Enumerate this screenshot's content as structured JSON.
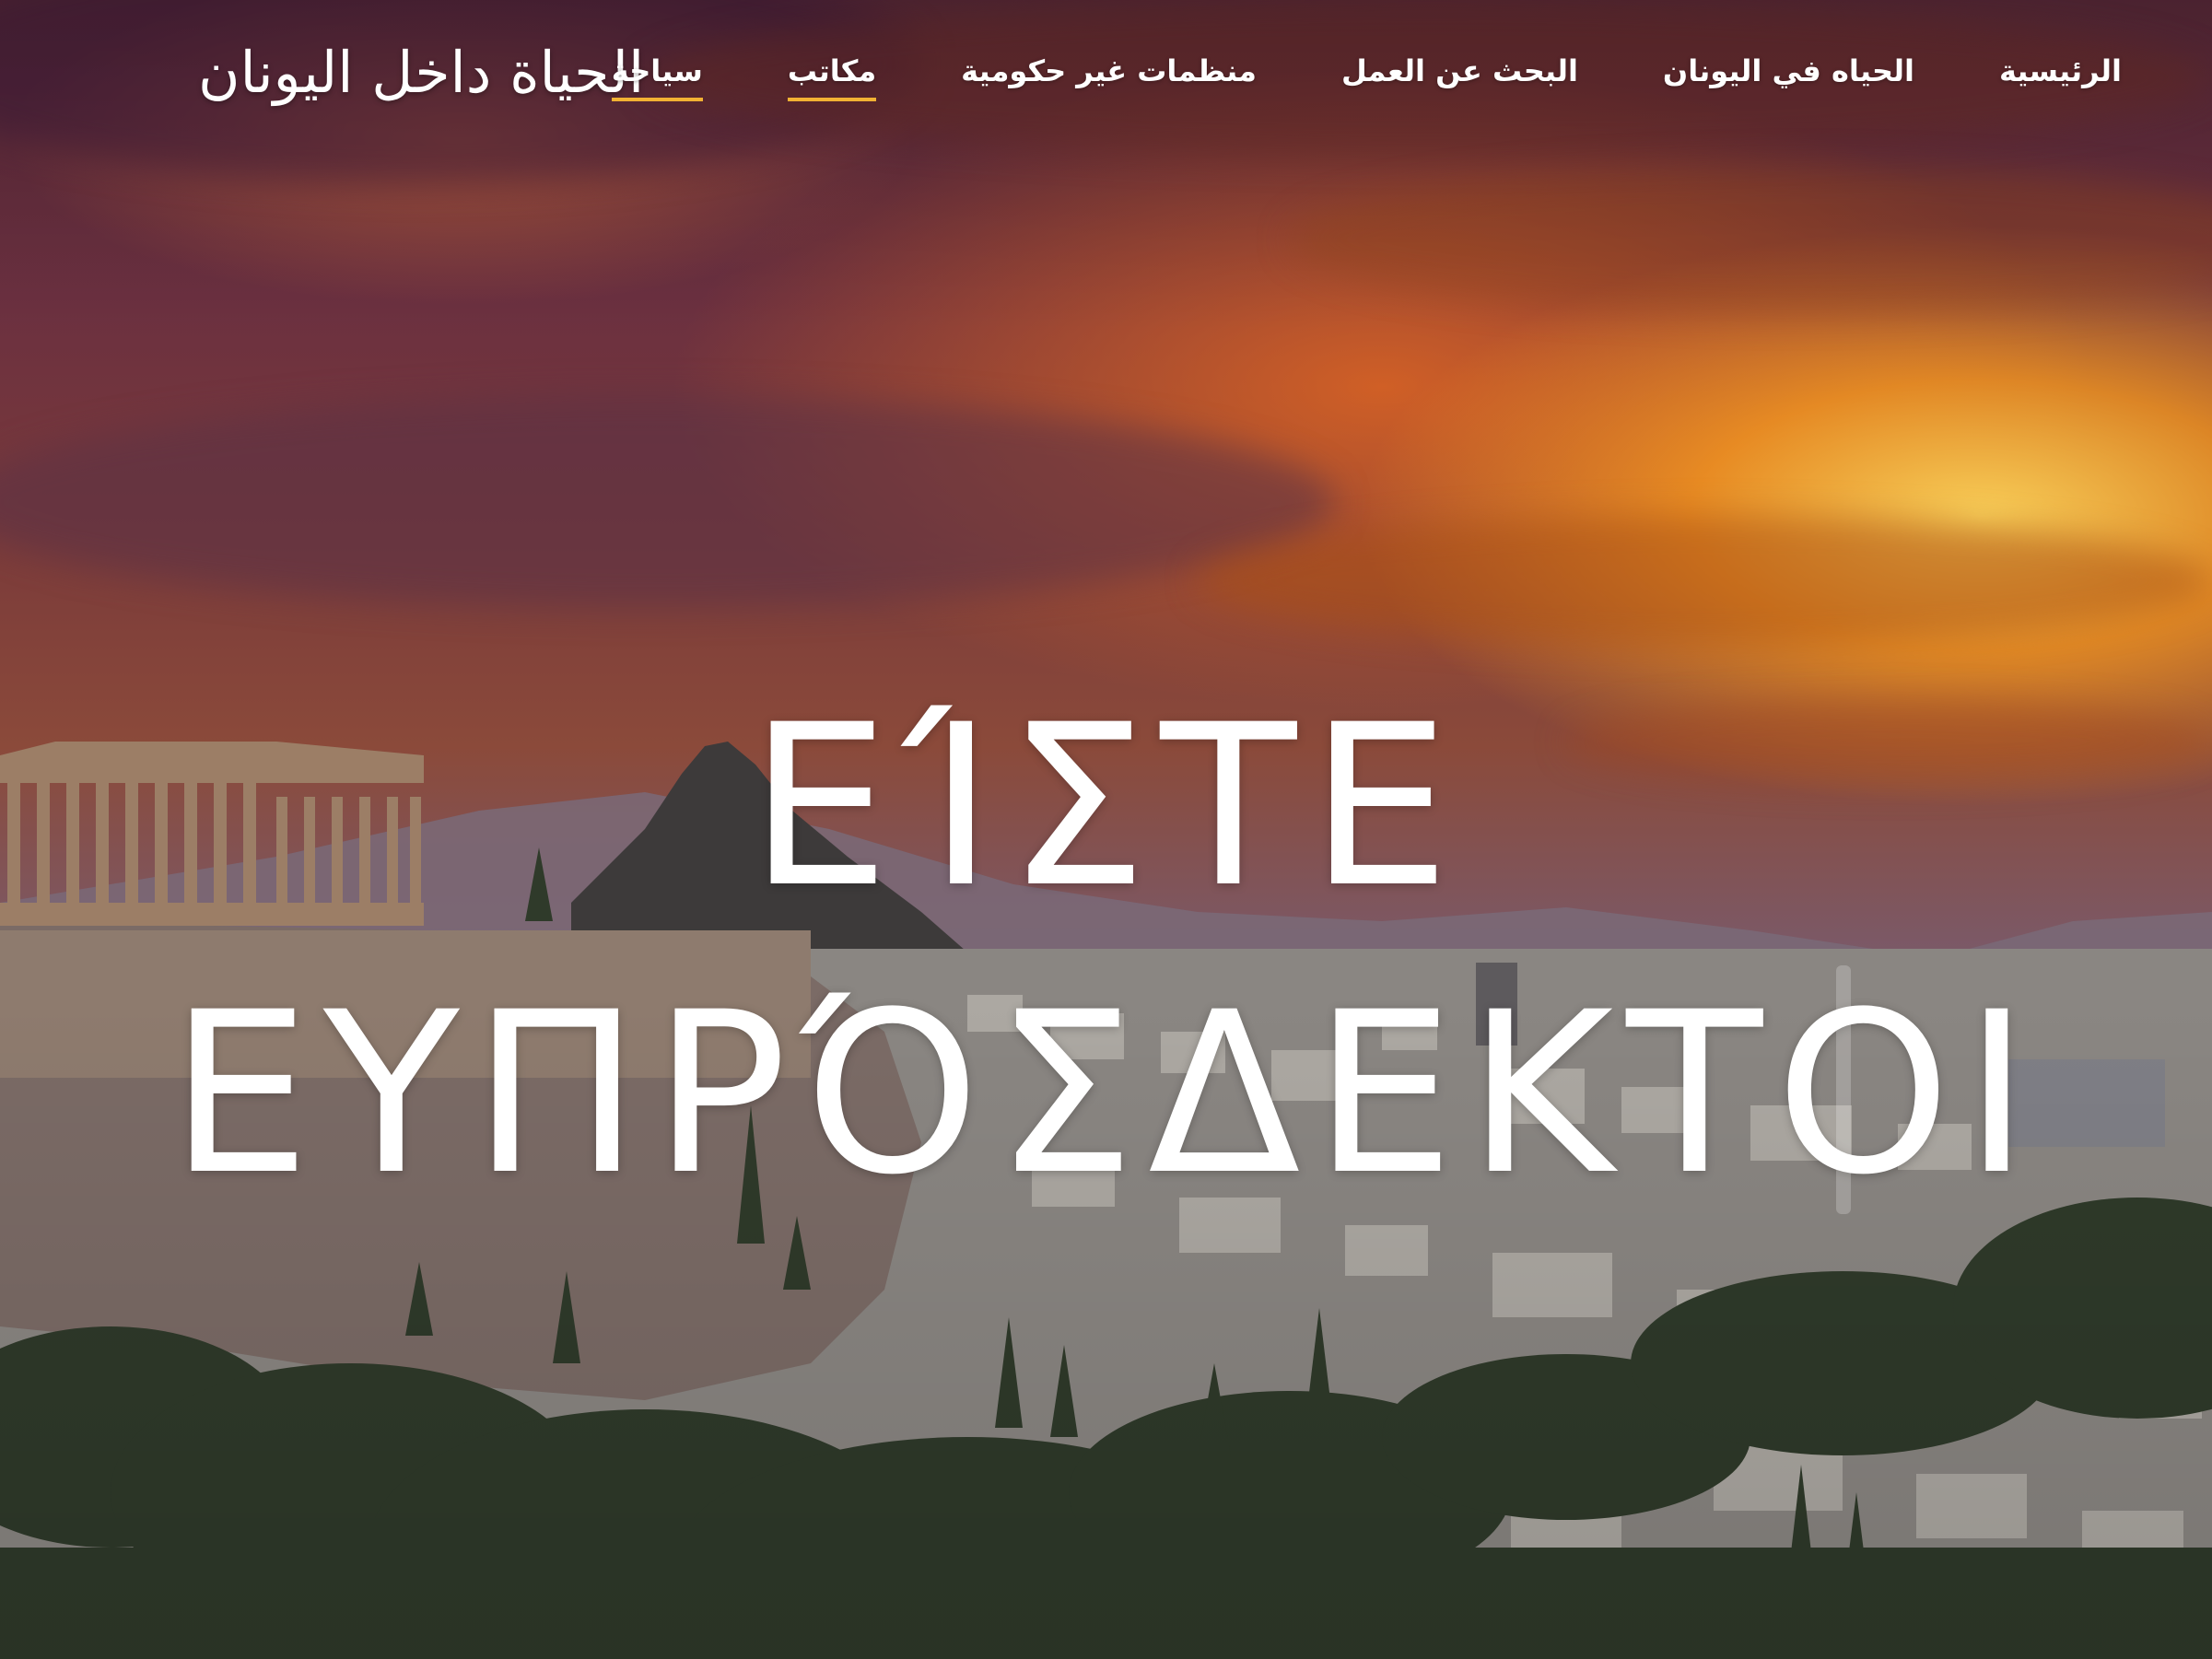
{
  "brand": {
    "title": "الحياة داخل اليونان"
  },
  "nav": {
    "items": [
      {
        "label": "الرئيسية",
        "underlined": false
      },
      {
        "label": "الحياه في اليونان",
        "underlined": false
      },
      {
        "label": "البحث عن العمل",
        "underlined": false
      },
      {
        "label": "منظمات غير حكومية",
        "underlined": false
      },
      {
        "label": "مكاتب",
        "underlined": true
      },
      {
        "label": "سياحة",
        "underlined": true
      }
    ]
  },
  "hero": {
    "line1": "ΕΊΣΤΕ",
    "line2": "ΕΥΠΡΌΣΔΕΚΤΟΙ"
  },
  "colors": {
    "accent_underline": "#f2b233",
    "text": "#ffffff"
  },
  "icons": {
    "scroll_indicator": "scrollbar-icon"
  }
}
